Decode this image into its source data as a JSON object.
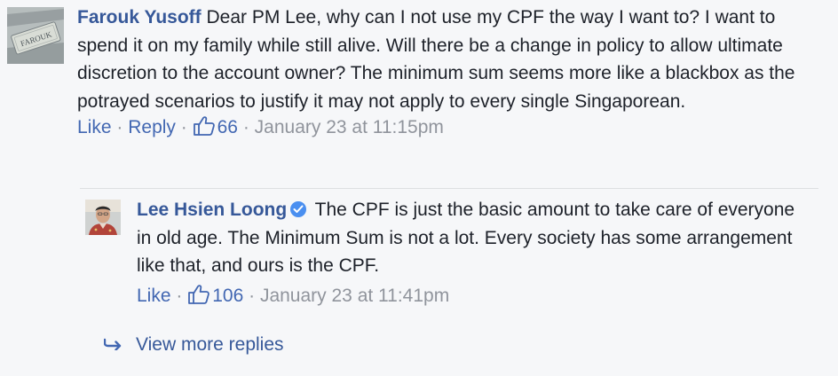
{
  "comment": {
    "author": "Farouk Yusoff",
    "avatar_text": "FAROUK",
    "text": "Dear PM Lee, why can I not use my CPF the way I want to? I want to spend it on my family while still alive. Will there be a change in policy to allow ultimate discretion to the account owner? The minimum sum seems more like a blackbox as the potrayed scenarios to justify it may not apply to every single Singaporean.",
    "like_label": "Like",
    "reply_label": "Reply",
    "like_count": "66",
    "timestamp": "January 23 at 11:15pm",
    "separator": "·"
  },
  "reply": {
    "author": "Lee Hsien Loong",
    "verified_icon": "verified-badge-icon",
    "text": "The CPF is just the basic amount to take care of everyone in old age. The Minimum Sum is not a lot. Every society has some arrangement like that, and ours is the CPF.",
    "like_label": "Like",
    "like_count": "106",
    "timestamp": "January 23 at 11:41pm",
    "separator": "·"
  },
  "view_more": {
    "label": "View more replies",
    "icon": "reply-arrow-icon"
  },
  "colors": {
    "background": "#f6f7f9",
    "author_link": "#365899",
    "action_link": "#4267b2",
    "meta_gray": "#90949c",
    "verified_blue": "#4a8ff0"
  }
}
